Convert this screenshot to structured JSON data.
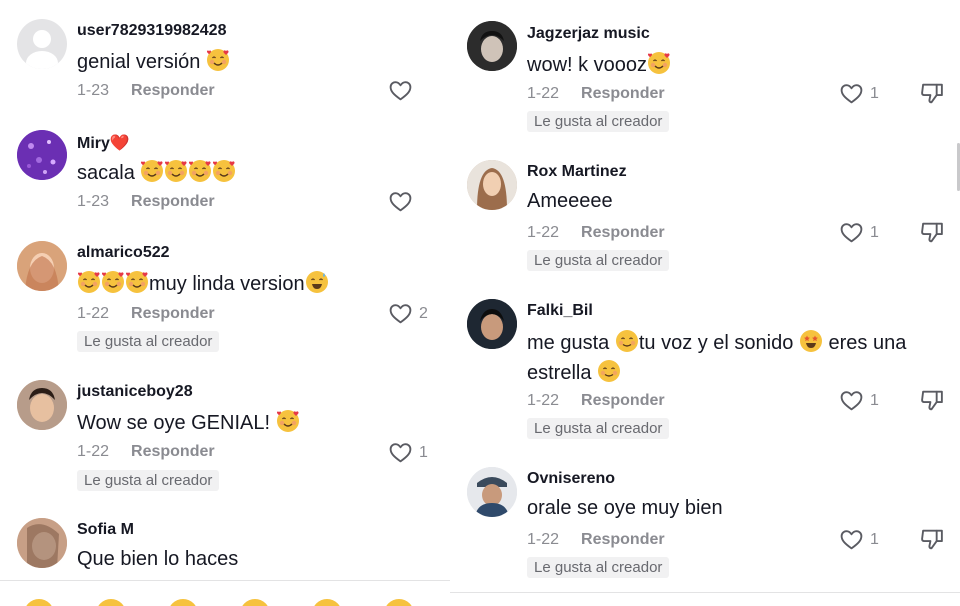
{
  "left_comments": [
    {
      "user": "user7829319982428",
      "text": "genial versión",
      "emojis_after": 1,
      "date": "1-23",
      "reply": "Responder",
      "likes": "",
      "creator_liked": ""
    },
    {
      "user": "Miry",
      "user_badge": "❤️",
      "text": "sacala",
      "emojis_after": 4,
      "date": "1-23",
      "reply": "Responder",
      "likes": "",
      "creator_liked": ""
    },
    {
      "user": "almarico522",
      "text_prefix_emojis": 3,
      "text": "muy linda version",
      "emoji_suffix": "sweat",
      "date": "1-22",
      "reply": "Responder",
      "likes": "2",
      "creator_liked": "Le gusta al creador"
    },
    {
      "user": "justaniceboy28",
      "text": "Wow se oye GENIAL!",
      "emojis_after": 1,
      "date": "1-22",
      "reply": "Responder",
      "likes": "1",
      "creator_liked": "Le gusta al creador"
    },
    {
      "user": "Sofia M",
      "text": "Que bien lo haces",
      "date": "",
      "reply": "",
      "likes": "",
      "creator_liked": ""
    }
  ],
  "right_comments": [
    {
      "user": "Jagzerjaz music",
      "text": "wow! k voooz",
      "emojis_after": 1,
      "date": "1-22",
      "reply": "Responder",
      "likes": "1",
      "creator_liked": "Le gusta al creador"
    },
    {
      "user": "Rox Martinez",
      "text": "Ameeeee",
      "date": "1-22",
      "reply": "Responder",
      "likes": "1",
      "creator_liked": "Le gusta al creador"
    },
    {
      "user": "Falki_Bil",
      "text_part1": "me gusta",
      "text_part2": "tu voz y el sonido",
      "text_part3": "eres una",
      "text_part4": "estrella",
      "date": "1-22",
      "reply": "Responder",
      "likes": "1",
      "creator_liked": "Le gusta al creador"
    },
    {
      "user": "Ovnisereno",
      "text": "orale se oye muy bien",
      "date": "1-22",
      "reply": "Responder",
      "likes": "1",
      "creator_liked": "Le gusta al creador"
    }
  ],
  "icons": {
    "like": "heart-outline-icon",
    "dislike": "thumbs-down-icon",
    "emoji_hearts": "smiling-face-with-hearts-emoji",
    "emoji_sweat": "grinning-sweat-emoji",
    "emoji_smile": "smiling-face-emoji",
    "emoji_star": "star-struck-emoji"
  },
  "colors": {
    "text": "#161823",
    "muted": "#8a8b91",
    "badge_bg": "#f1f1f2",
    "emoji_yellow": "#f6c23e"
  }
}
